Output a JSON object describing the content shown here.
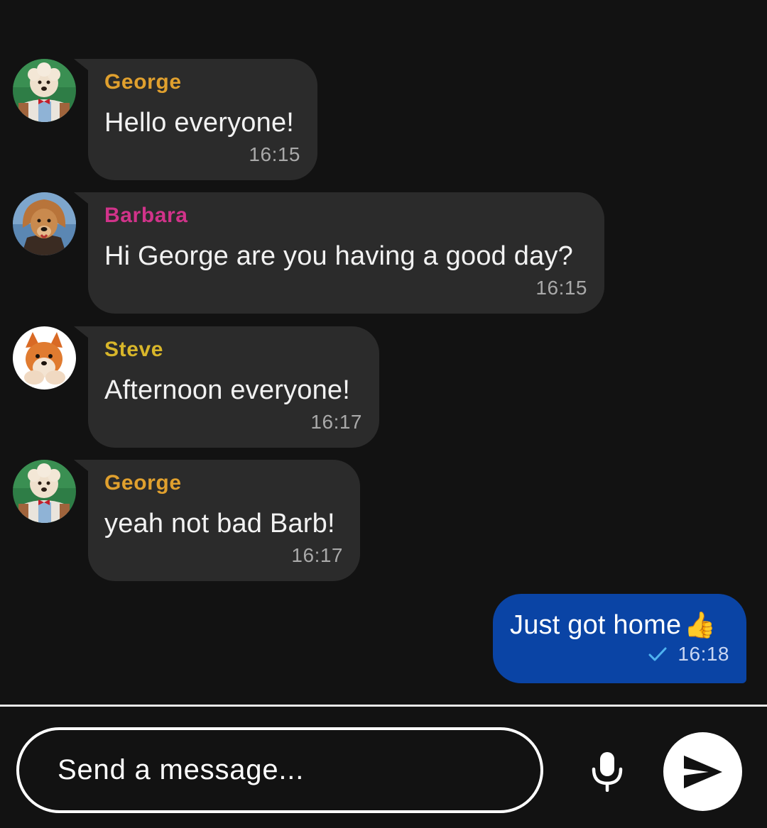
{
  "messages": [
    {
      "sender": "George",
      "sender_color": "#e0a02e",
      "text": "Hello everyone!",
      "time": "16:15",
      "avatar": "poodle-avatar"
    },
    {
      "sender": "Barbara",
      "sender_color": "#d1338a",
      "text": "Hi George are you having a good day?",
      "time": "16:15",
      "avatar": "dog-wig-avatar"
    },
    {
      "sender": "Steve",
      "sender_color": "#d8b62a",
      "text": "Afternoon everyone!",
      "time": "16:17",
      "avatar": "fox-pomeranian-avatar"
    },
    {
      "sender": "George",
      "sender_color": "#e0a02e",
      "text": "yeah not bad Barb!",
      "time": "16:17",
      "avatar": "poodle-avatar"
    }
  ],
  "my_message": {
    "text": "Just got home",
    "emoji": "👍",
    "time": "16:18",
    "status_icon": "check-icon",
    "bubble_color": "#0a44a5"
  },
  "composer": {
    "placeholder": "Send a message...",
    "mic_icon": "mic-icon",
    "send_icon": "send-icon"
  }
}
